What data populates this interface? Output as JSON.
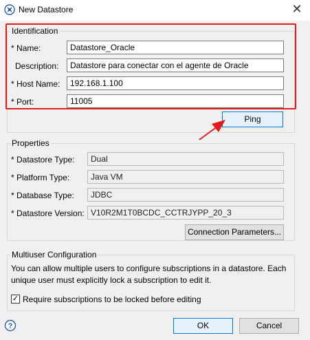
{
  "window": {
    "title": "New Datastore",
    "close_glyph": "✕"
  },
  "identification": {
    "group_title": "Identification",
    "name": {
      "label": "* Name:",
      "value": "Datastore_Oracle"
    },
    "description": {
      "label": "Description:",
      "value": "Datastore para conectar con el agente de Oracle"
    },
    "host_name": {
      "label": "* Host Name:",
      "value": "192.168.1.100"
    },
    "port": {
      "label": "* Port:",
      "value": "11005"
    }
  },
  "ping_button": {
    "label": "Ping"
  },
  "properties": {
    "group_title": "Properties",
    "datastore_type": {
      "label": "* Datastore Type:",
      "value": "Dual"
    },
    "platform_type": {
      "label": "* Platform Type:",
      "value": "Java VM"
    },
    "database_type": {
      "label": "* Database Type:",
      "value": "JDBC"
    },
    "datastore_version": {
      "label": "* Datastore Version:",
      "value": "V10R2M1T0BCDC_CCTRJYPP_20_3"
    },
    "connection_parameters_button": "Connection Parameters..."
  },
  "multiuser": {
    "group_title": "Multiuser Configuration",
    "description_line1": "You can allow multiple users to configure subscriptions in a datastore. Each",
    "description_line2": "unique user must explicitly lock a subscription to edit it.",
    "checkbox_label": "Require subscriptions to be locked before editing",
    "checkbox_checked": true,
    "checkbox_glyph": "✓"
  },
  "footer": {
    "ok_label": "OK",
    "cancel_label": "Cancel"
  },
  "icons": {
    "app": "datastore-icon",
    "help": "help-icon",
    "annotation": "red-arrow-icon"
  },
  "colors": {
    "annotation_red": "#e3191c",
    "focus_blue": "#0078d7"
  }
}
